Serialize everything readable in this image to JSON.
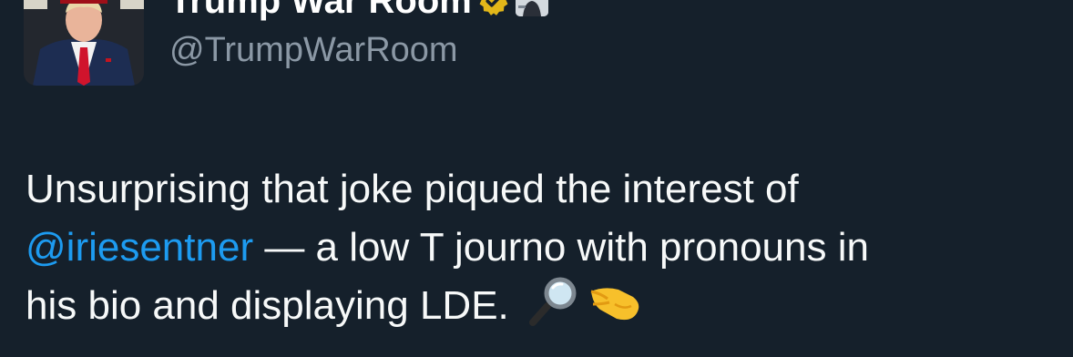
{
  "author": {
    "display_name": "Trump War Room",
    "handle": "@TrumpWarRoom",
    "verified_badge": "gold-verified-icon",
    "affiliate_badge": "affiliate-avatar-badge"
  },
  "tweet": {
    "line1": "Unsurprising that joke piqued the interest of",
    "mention": "@iriesentner",
    "line2_rest": " — a low T journo with pronouns in",
    "line3": "his bio and displaying LDE.",
    "emojis": [
      "magnifying-glass-icon",
      "pinching-hand-icon"
    ]
  },
  "colors": {
    "background": "#15202b",
    "text": "#f7f9f9",
    "secondary_text": "#8b98a5",
    "link": "#1d9bf0",
    "verified_gold": "#e2b719"
  }
}
